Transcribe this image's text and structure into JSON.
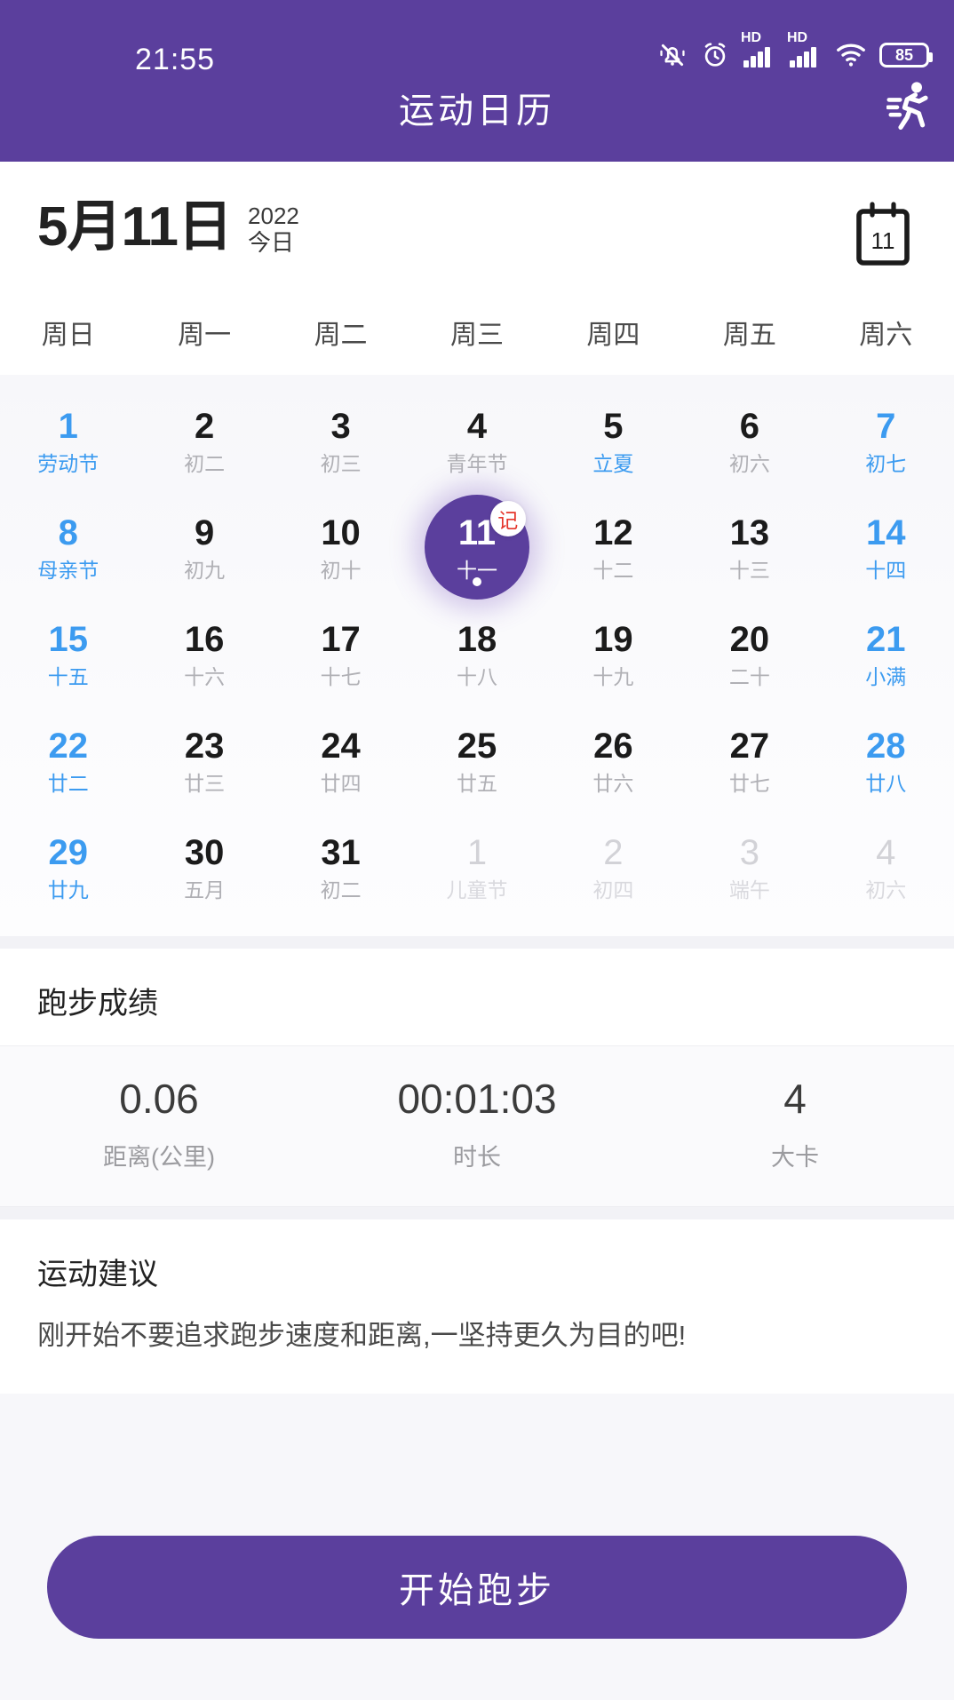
{
  "status_bar": {
    "time": "21:55",
    "battery_level": "85",
    "network_label": "HD",
    "icons": [
      "mute-bell-icon",
      "alarm-clock-icon",
      "hd-signal-icon",
      "hd-signal-icon",
      "wifi-icon",
      "battery-icon"
    ]
  },
  "app_bar": {
    "title": "运动日历",
    "action_icon": "runner-icon"
  },
  "date_header": {
    "date": "5月11日",
    "year": "2022",
    "today_label": "今日",
    "calendar_icon_day": "11"
  },
  "calendar": {
    "weekdays": [
      "周日",
      "周一",
      "周二",
      "周三",
      "周四",
      "周五",
      "周六"
    ],
    "accent_purple": "#5b3f9d",
    "accent_blue": "#3c9bf0",
    "badge_red": "#e5352b",
    "note_badge_label": "记",
    "rows": [
      [
        {
          "num": "1",
          "sub": "劳动节",
          "style": "blue"
        },
        {
          "num": "2",
          "sub": "初二",
          "style": "normal"
        },
        {
          "num": "3",
          "sub": "初三",
          "style": "normal"
        },
        {
          "num": "4",
          "sub": "青年节",
          "style": "normal"
        },
        {
          "num": "5",
          "sub": "立夏",
          "style": "sub-blue"
        },
        {
          "num": "6",
          "sub": "初六",
          "style": "normal"
        },
        {
          "num": "7",
          "sub": "初七",
          "style": "blue"
        }
      ],
      [
        {
          "num": "8",
          "sub": "母亲节",
          "style": "blue"
        },
        {
          "num": "9",
          "sub": "初九",
          "style": "normal"
        },
        {
          "num": "10",
          "sub": "初十",
          "style": "normal"
        },
        {
          "num": "11",
          "sub": "十一",
          "style": "selected",
          "badge": "记",
          "dot": true
        },
        {
          "num": "12",
          "sub": "十二",
          "style": "normal"
        },
        {
          "num": "13",
          "sub": "十三",
          "style": "normal"
        },
        {
          "num": "14",
          "sub": "十四",
          "style": "blue"
        }
      ],
      [
        {
          "num": "15",
          "sub": "十五",
          "style": "blue"
        },
        {
          "num": "16",
          "sub": "十六",
          "style": "normal"
        },
        {
          "num": "17",
          "sub": "十七",
          "style": "normal"
        },
        {
          "num": "18",
          "sub": "十八",
          "style": "normal"
        },
        {
          "num": "19",
          "sub": "十九",
          "style": "normal"
        },
        {
          "num": "20",
          "sub": "二十",
          "style": "normal"
        },
        {
          "num": "21",
          "sub": "小满",
          "style": "blue"
        }
      ],
      [
        {
          "num": "22",
          "sub": "廿二",
          "style": "blue"
        },
        {
          "num": "23",
          "sub": "廿三",
          "style": "normal"
        },
        {
          "num": "24",
          "sub": "廿四",
          "style": "normal"
        },
        {
          "num": "25",
          "sub": "廿五",
          "style": "normal"
        },
        {
          "num": "26",
          "sub": "廿六",
          "style": "normal"
        },
        {
          "num": "27",
          "sub": "廿七",
          "style": "normal"
        },
        {
          "num": "28",
          "sub": "廿八",
          "style": "blue"
        }
      ],
      [
        {
          "num": "29",
          "sub": "廿九",
          "style": "blue"
        },
        {
          "num": "30",
          "sub": "五月",
          "style": "normal"
        },
        {
          "num": "31",
          "sub": "初二",
          "style": "normal"
        },
        {
          "num": "1",
          "sub": "儿童节",
          "style": "muted"
        },
        {
          "num": "2",
          "sub": "初四",
          "style": "muted"
        },
        {
          "num": "3",
          "sub": "端午",
          "style": "muted"
        },
        {
          "num": "4",
          "sub": "初六",
          "style": "muted"
        }
      ]
    ]
  },
  "running_stats": {
    "title": "跑步成绩",
    "items": [
      {
        "value": "0.06",
        "label": "距离(公里)"
      },
      {
        "value": "00:01:03",
        "label": "时长"
      },
      {
        "value": "4",
        "label": "大卡"
      }
    ]
  },
  "advice": {
    "title": "运动建议",
    "text": "刚开始不要追求跑步速度和距离,一坚持更久为目的吧!"
  },
  "footer": {
    "start_button_label": "开始跑步"
  }
}
